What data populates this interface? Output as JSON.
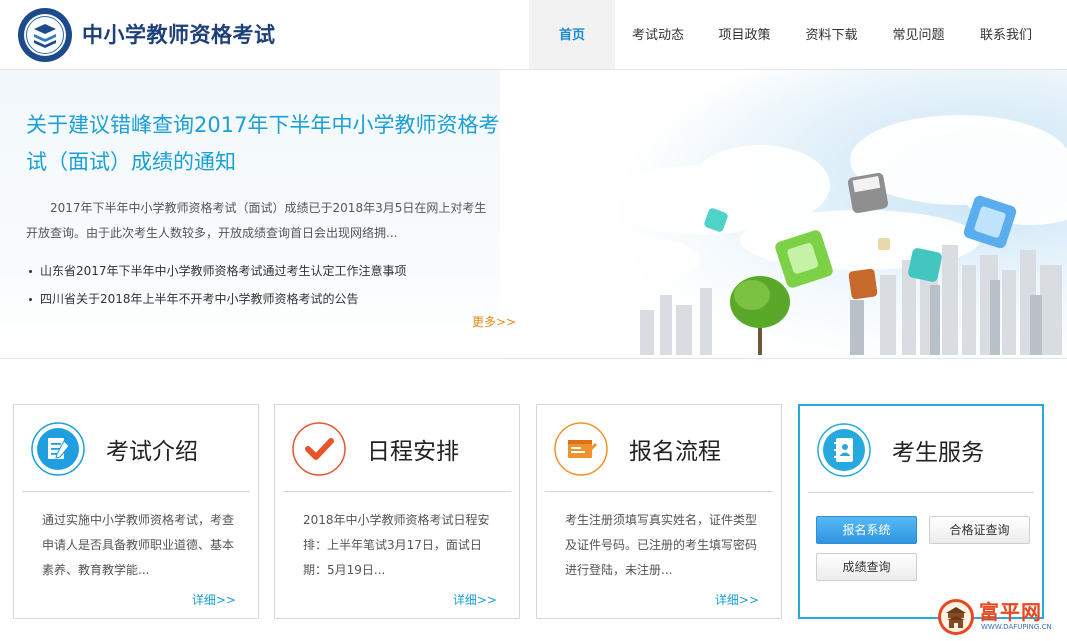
{
  "header": {
    "site_title": "中小学教师资格考试",
    "nav": [
      {
        "label": "首页",
        "active": true
      },
      {
        "label": "考试动态",
        "active": false
      },
      {
        "label": "项目政策",
        "active": false
      },
      {
        "label": "资料下载",
        "active": false
      },
      {
        "label": "常见问题",
        "active": false
      },
      {
        "label": "联系我们",
        "active": false
      }
    ]
  },
  "banner": {
    "news_title": "关于建议错峰查询2017年下半年中小学教师资格考试（面试）成绩的通知",
    "news_summary": "2017年下半年中小学教师资格考试（面试）成绩已于2018年3月5日在网上对考生开放查询。由于此次考生人数较多，开放成绩查询首日会出现网络拥...",
    "news_list": [
      "山东省2017年下半年中小学教师资格考试通过考生认定工作注意事项",
      "四川省关于2018年上半年不开考中小学教师资格考试的公告"
    ],
    "more_label": "更多>>"
  },
  "cards": [
    {
      "title": "考试介绍",
      "text": "通过实施中小学教师资格考试，考查申请人是否具备教师职业道德、基本素养、教育教学能...",
      "detail_label": "详细>>",
      "icon": "document-pen-icon"
    },
    {
      "title": "日程安排",
      "text": "2018年中小学教师资格考试日程安排：上半年笔试3月17日，面试日期：5月19日...",
      "detail_label": "详细>>",
      "icon": "checkmark-icon"
    },
    {
      "title": "报名流程",
      "text": "考生注册须填写真实姓名，证件类型及证件号码。已注册的考生填写密码进行登陆，未注册...",
      "detail_label": "详细>>",
      "icon": "form-pen-icon"
    },
    {
      "title": "考生服务",
      "icon": "address-book-icon",
      "buttons": [
        "报名系统",
        "合格证查询",
        "成绩查询"
      ]
    }
  ],
  "watermark": {
    "name": "富平网",
    "url": "WWW.DAFUPING.CN"
  },
  "colors": {
    "accent_blue": "#1a9fd6",
    "title_navy": "#1d3f7a",
    "more_orange": "#e88b1c",
    "check_red": "#e8542b",
    "form_orange": "#f0922b"
  }
}
